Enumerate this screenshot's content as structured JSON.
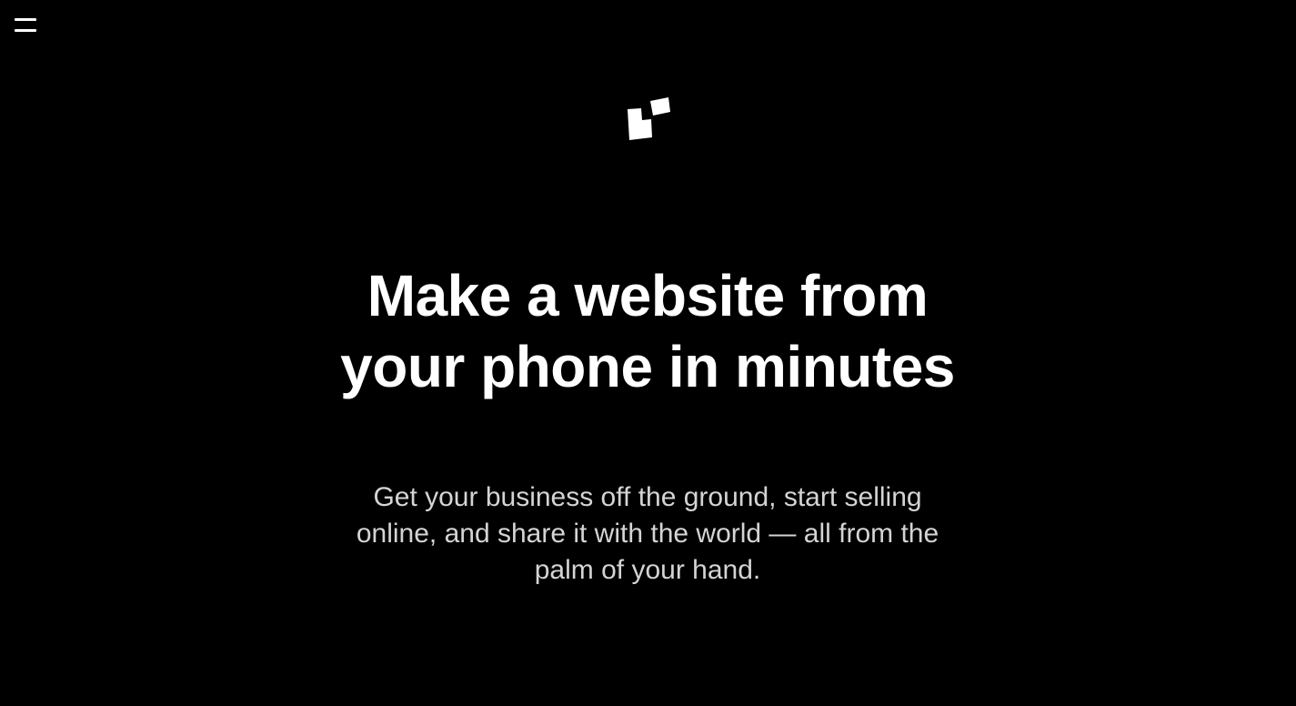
{
  "nav": {
    "menu_icon": "hamburger-menu-icon"
  },
  "brand": {
    "logo_icon": "squarespace-logo-mark-icon",
    "logo_color": "#ffffff"
  },
  "hero": {
    "title_line1": "Make a website from",
    "title_line2": "your phone in minutes",
    "subtitle_line1": "Get your business off the ground, start selling",
    "subtitle_line2": "online, and share it with the world — all from the",
    "subtitle_line3": "palm of your hand."
  },
  "colors": {
    "background": "#000000",
    "title_text": "#ffffff",
    "subtitle_text": "#d4d4d4"
  }
}
